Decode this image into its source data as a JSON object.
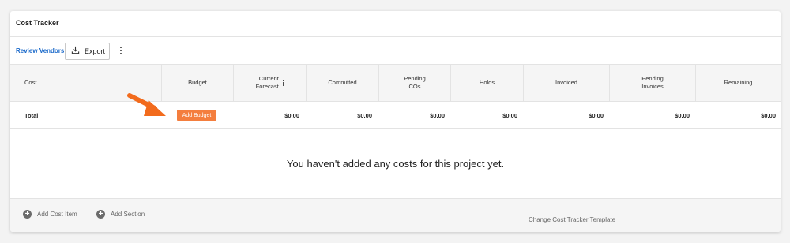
{
  "header": {
    "title": "Cost Tracker"
  },
  "toolbar": {
    "review_vendors": "Review Vendors",
    "export_label": "Export"
  },
  "columns": [
    {
      "label": "Cost"
    },
    {
      "label": "Budget"
    },
    {
      "label": "Current\nForecast"
    },
    {
      "label": "Committed"
    },
    {
      "label": "Pending\nCOs"
    },
    {
      "label": "Holds"
    },
    {
      "label": "Invoiced"
    },
    {
      "label": "Pending\nInvoices"
    },
    {
      "label": "Remaining"
    }
  ],
  "total_row": {
    "label": "Total",
    "add_budget": "Add Budget",
    "current_forecast": "$0.00",
    "committed": "$0.00",
    "pending_cos": "$0.00",
    "holds": "$0.00",
    "invoiced": "$0.00",
    "pending_invoices": "$0.00",
    "remaining": "$0.00"
  },
  "empty_message": "You haven't added any costs for this project yet.",
  "footer": {
    "add_cost_item": "Add Cost Item",
    "add_section": "Add Section",
    "change_template": "Change Cost Tracker Template"
  },
  "colors": {
    "accent_orange": "#f47e3e",
    "link_blue": "#1868c9",
    "arrow_orange": "#f26b1d"
  }
}
